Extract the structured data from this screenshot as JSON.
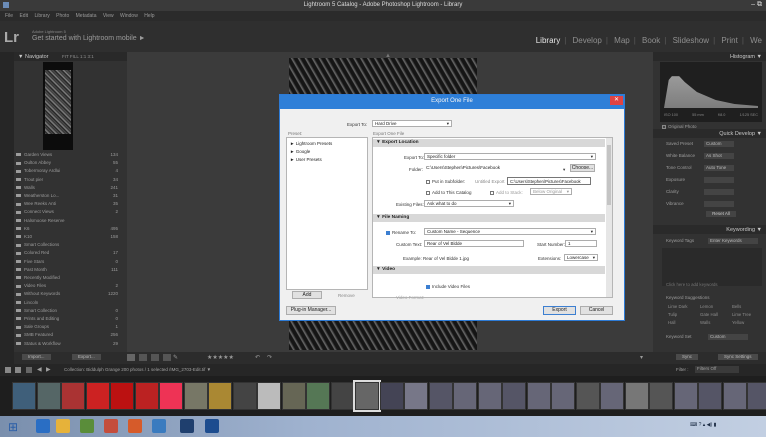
{
  "window": {
    "title": "Lightroom 5 Catalog - Adobe Photoshop Lightroom - Library",
    "controls": "–  ⧉"
  },
  "menu": [
    "File",
    "Edit",
    "Library",
    "Photo",
    "Metadata",
    "View",
    "Window",
    "Help"
  ],
  "identity": {
    "small": "Adobe Lightroom 5",
    "main": "Get started with Lightroom mobile ►",
    "logo": "Lr"
  },
  "modules": [
    "Library",
    "Develop",
    "Map",
    "Book",
    "Slideshow",
    "Print",
    "We"
  ],
  "left_panel": {
    "navigator": "▼ Navigator",
    "navigator_opts": "FIT  FILL  1:1  3:1",
    "folders": [
      {
        "label": "Garden Views",
        "count": "134"
      },
      {
        "label": "Oulton Abbey",
        "count": "55"
      },
      {
        "label": "Tobermoray Ardlui",
        "count": "4"
      },
      {
        "label": "Trout pier",
        "count": "34"
      },
      {
        "label": "Walls",
        "count": "241"
      },
      {
        "label": "Weatherston Lo...",
        "count": "31"
      },
      {
        "label": "Wee Reeks Anti",
        "count": "35"
      },
      {
        "label": "Connect Views",
        "count": "2"
      },
      {
        "label": "Halsmoose Reserve",
        "count": ""
      },
      {
        "label": "K6",
        "count": "495"
      },
      {
        "label": "K10",
        "count": "158"
      },
      {
        "label": "Smart Collections",
        "count": ""
      },
      {
        "label": "Colored Red",
        "count": "17"
      },
      {
        "label": "Five Stars",
        "count": "0"
      },
      {
        "label": "Past Month",
        "count": "111"
      },
      {
        "label": "Recently Modified",
        "count": ""
      },
      {
        "label": "Video Files",
        "count": "2"
      },
      {
        "label": "Without Keywords",
        "count": "1220"
      },
      {
        "label": "Lincoln",
        "count": ""
      },
      {
        "label": "Smart Collection",
        "count": "0"
      },
      {
        "label": "Prints and Editing",
        "count": "0"
      },
      {
        "label": "Sale Groups",
        "count": "1"
      },
      {
        "label": "SMB Featured",
        "count": "256"
      },
      {
        "label": "Status & Workflow",
        "count": "29"
      }
    ],
    "import_btn": "Import...",
    "export_btn": "Export..."
  },
  "right_panel": {
    "histogram": "Histogram ▼",
    "exif": [
      "ISO 100",
      "55 mm",
      "f/8.0",
      "1/125 SEC"
    ],
    "original_photo": "Original Photo",
    "quick_develop": "Quick Develop ▼",
    "rows": [
      {
        "label": "Saved Preset",
        "value": "Custom"
      },
      {
        "label": "White Balance",
        "value": "As Shot"
      },
      {
        "label": "Tone Control",
        "value": "Auto Tone"
      },
      {
        "label": "Exposure",
        "value": ""
      },
      {
        "label": "Clarity",
        "value": ""
      },
      {
        "label": "Vibrance",
        "value": ""
      }
    ],
    "reset_all": "Reset All",
    "keywording": "Keywording ▼",
    "keyword_tags": "Keyword Tags",
    "keyword_tags_value": "Enter Keywords",
    "click_here": "Click here to add keywords",
    "keyword_suggestions": "Keyword Suggestions",
    "suggestions": [
      "Lime Dark",
      "Lemon",
      "Bells",
      "Tulip",
      "Gate Hall",
      "Lime Tree",
      "Hall",
      "Walls",
      "Yellow"
    ],
    "keyword_set": "Keyword Set",
    "keyword_set_value": "Custom",
    "sync": "Sync",
    "sync_settings": "Sync Settings"
  },
  "toolbar": {
    "sort": "Sort",
    "stars": "★★★★★"
  },
  "filmstrip": {
    "info": "Collection: Biddulph Grange    200 photos / 1 selected /IMG_2703-Edit.tif ▼",
    "filter": "Filter :",
    "filter_value": "Filters Off"
  },
  "dialog": {
    "title": "Export One File",
    "export_to_label": "Export To:",
    "export_to_value": "Hard Drive",
    "preset_header": "Preset:",
    "files_header": "Export One File",
    "presets": [
      "► Lightroom Presets",
      "► Google",
      "► User Presets"
    ],
    "add": "Add",
    "remove": "Remove",
    "plugin_manager": "Plug-in Manager...",
    "export": "Export",
    "cancel": "Cancel",
    "sections": {
      "export_location": "▼ Export Location",
      "file_naming": "▼ File Naming",
      "video": "▼ Video"
    },
    "location": {
      "export_to_label": "Export To:",
      "export_to_value": "Specific folder",
      "folder_label": "Folder:",
      "folder_value": "C:\\Users\\Stephen\\Pictures\\Facebook",
      "choose": "Choose...",
      "put_in_subfolder": "Put in Subfolder:",
      "subfolder_value": "Untitled Export",
      "tooltip": "C:\\Users\\Stephen\\Pictures\\Facebook",
      "add_to_catalog": "Add to This Catalog",
      "add_to_stack": "Add to Stack:",
      "below_original": "Below Original",
      "existing_files_label": "Existing Files:",
      "existing_files_value": "Ask what to do"
    },
    "naming": {
      "rename_to": "Rename To:",
      "rename_value": "Custom Name - Sequence",
      "custom_text_label": "Custom Text:",
      "custom_text_value": "Rear of Vel Bldde",
      "start_number_label": "Start Number:",
      "start_number_value": "1",
      "example": "Example: Rear of Vel Bldde 1.jpg",
      "extensions_label": "Extensions:",
      "extensions_value": "Lowercase"
    },
    "video": {
      "include": "Include Video Files",
      "format_label": "Video Format:"
    }
  }
}
